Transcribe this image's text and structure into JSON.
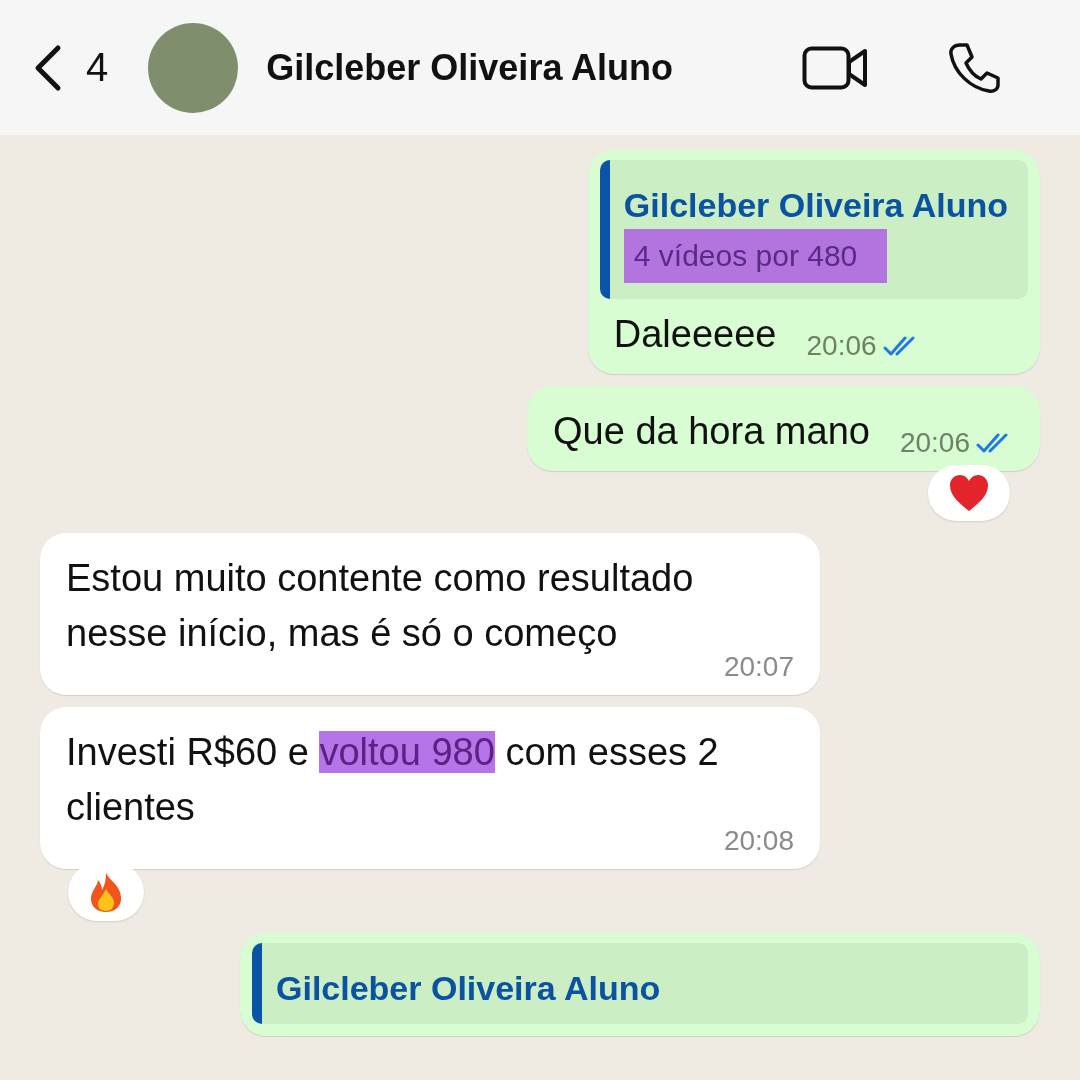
{
  "header": {
    "back_count": "4",
    "contact_name": "Gilcleber Oliveira Aluno"
  },
  "messages": [
    {
      "kind": "out",
      "quote": {
        "author": "Gilcleber Oliveira Aluno",
        "text": "4 vídeos por 480",
        "highlighted": true
      },
      "segments": [
        {
          "text": "Daleeeee",
          "highlighted": false
        }
      ],
      "time": "20:06",
      "read": true
    },
    {
      "kind": "out",
      "segments": [
        {
          "text": "Que da hora mano",
          "highlighted": false
        }
      ],
      "time": "20:06",
      "read": true,
      "reaction": {
        "kind": "heart"
      }
    },
    {
      "kind": "in",
      "segments": [
        {
          "text": "Estou muito contente como resultado nesse início, mas é só o começo",
          "highlighted": false
        }
      ],
      "time": "20:07"
    },
    {
      "kind": "in",
      "segments": [
        {
          "text": "Investi R$60 e ",
          "highlighted": false
        },
        {
          "text": "voltou 980",
          "highlighted": true
        },
        {
          "text": " com esses 2 clientes",
          "highlighted": false
        }
      ],
      "time": "20:08",
      "reaction": {
        "kind": "fire"
      }
    },
    {
      "kind": "out",
      "quote": {
        "author": "Gilcleber Oliveira Aluno"
      }
    }
  ]
}
